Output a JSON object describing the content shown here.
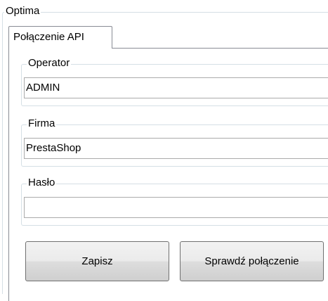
{
  "group": {
    "title": "Optima"
  },
  "tabs": [
    {
      "label": "Połączenie API",
      "active": true
    }
  ],
  "fields": {
    "operator": {
      "label": "Operator",
      "value": "ADMIN"
    },
    "firma": {
      "label": "Firma",
      "value": "PrestaShop"
    },
    "haslo": {
      "label": "Hasło",
      "value": ""
    }
  },
  "buttons": {
    "save_label": "Zapisz",
    "test_label": "Sprawdź połączenie"
  }
}
